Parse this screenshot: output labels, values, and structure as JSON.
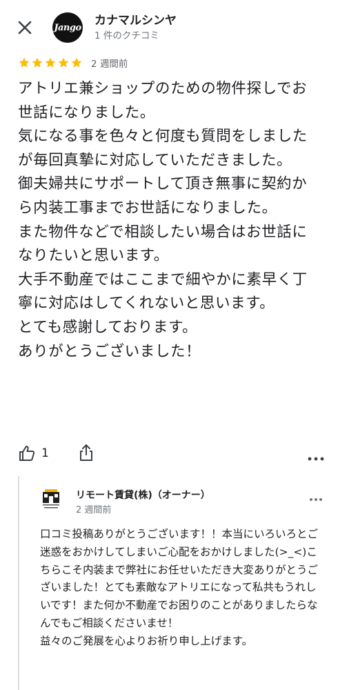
{
  "reviewer": {
    "name": "カナマルシンヤ",
    "meta": "1 件のクチコミ",
    "avatar_text": "Jango"
  },
  "review": {
    "rating": 5,
    "star_color": "#fbbc04",
    "time": "2 週間前",
    "text": "アトリエ兼ショップのための物件探しでお世話になりました。\n気になる事を色々と何度も質問をしましたが毎回真摯に対応していただきました。\n御夫婦共にサポートして頂き無事に契約から内装工事までお世話になりました。\nまた物件などで相談したい場合はお世話になりたいと思います。\n大手不動産ではここまで細やかに素早く丁寧に対応はしてくれないと思います。\nとても感謝しております。\nありがとうございました！"
  },
  "actions": {
    "like_count": "1",
    "like_icon": "thumbs-up-icon",
    "share_icon": "share-icon",
    "more_icon": "more-horizontal-icon"
  },
  "reply": {
    "owner_name": "リモート賃貸(株)（オーナー）",
    "time": "2 週間前",
    "logo_text": "remote rental リモート",
    "text": "口コミ投稿ありがとうございます！！本当にいろいろとご迷惑をおかけしてしまいご心配をおかけしました(>_<)こちらこそ内装まで弊社にお任せいただき大変ありがとうございました！とても素敵なアトリエになって私共もうれしいです！また何か不動産でお困りのことがありましたらなんでもご相談くださいませ！\n益々のご発展を心よりお祈り申し上げます。"
  }
}
